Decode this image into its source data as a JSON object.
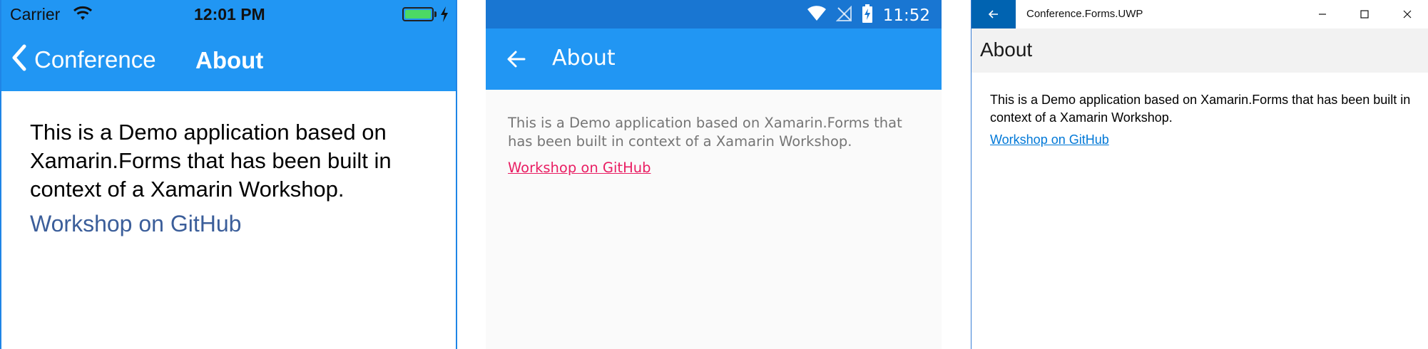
{
  "ios": {
    "carrier": "Carrier",
    "time": "12:01 PM",
    "back_label": "Conference",
    "title": "About",
    "description": "This is a Demo application based on Xamarin.Forms that has been built in context of a Xamarin Workshop.",
    "link": "Workshop on GitHub",
    "colors": {
      "nav": "#2196f3",
      "link": "#3b5e9a",
      "battery": "#4cd964"
    },
    "icons": [
      "wifi-icon",
      "battery-icon",
      "charging-icon",
      "chevron-left-icon"
    ]
  },
  "android": {
    "time": "11:52",
    "title": "About",
    "description": "This is a Demo application based on Xamarin.Forms that has been built in context of a Xamarin Workshop.",
    "link": "Workshop on GitHub",
    "colors": {
      "status": "#1976d2",
      "toolbar": "#2196f3",
      "link": "#e91e63"
    },
    "icons": [
      "wifi-icon",
      "no-signal-icon",
      "battery-charging-icon",
      "arrow-back-icon"
    ]
  },
  "uwp": {
    "window_title": "Conference.Forms.UWP",
    "title": "About",
    "description": "This is a Demo application based on Xamarin.Forms that has been built in context of a Xamarin Workshop.",
    "link": "Workshop on GitHub",
    "colors": {
      "back": "#0063b1",
      "header": "#f2f2f2",
      "link": "#0078d7"
    },
    "icons": [
      "arrow-back-icon",
      "minimize-icon",
      "maximize-icon",
      "close-icon"
    ]
  }
}
